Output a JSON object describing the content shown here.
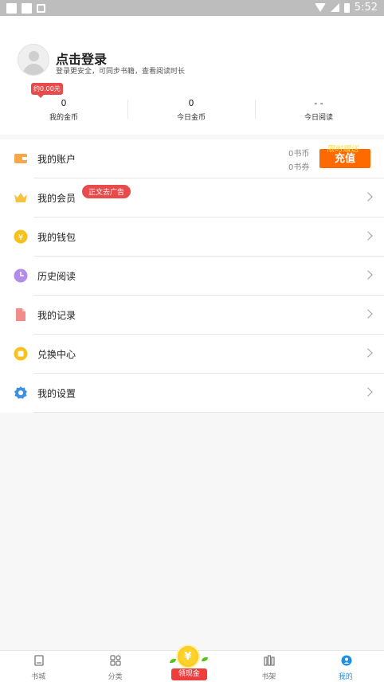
{
  "status_bar": {
    "time": "5:52"
  },
  "profile": {
    "title": "点击登录",
    "subtitle": "登录更安全，可同步书籍，查看阅读时长",
    "coin_badge": "约0.00元"
  },
  "stats": [
    {
      "value": "0",
      "label": "我的金币"
    },
    {
      "value": "0",
      "label": "今日金币"
    },
    {
      "value": "- -",
      "label": "今日阅读"
    }
  ],
  "account": {
    "label": "我的账户",
    "book_coins": "0书币",
    "book_vouchers": "0书券",
    "recharge_tag": "限时赠送",
    "recharge_label": "充值"
  },
  "menu": [
    {
      "key": "vip",
      "label": "我的会员",
      "tag": "正文去广告",
      "icon": "crown-icon"
    },
    {
      "key": "wallet",
      "label": "我的钱包",
      "icon": "wallet-coin-icon"
    },
    {
      "key": "history",
      "label": "历史阅读",
      "icon": "clock-icon"
    },
    {
      "key": "records",
      "label": "我的记录",
      "icon": "document-icon"
    },
    {
      "key": "exchange",
      "label": "兑换中心",
      "icon": "exchange-icon"
    },
    {
      "key": "settings",
      "label": "我的设置",
      "icon": "gear-icon"
    }
  ],
  "bottom_nav": [
    {
      "label": "书城",
      "icon": "book-icon",
      "active": false
    },
    {
      "label": "分类",
      "icon": "grid-icon",
      "active": false
    },
    {
      "label": "领现金",
      "icon": "coin-icon",
      "active": false
    },
    {
      "label": "书架",
      "icon": "bookshelf-icon",
      "active": false
    },
    {
      "label": "我的",
      "icon": "profile-icon",
      "active": true
    }
  ],
  "colors": {
    "accent": "#1e8fe6",
    "orange": "#ff6a00",
    "red": "#e84b4b"
  }
}
